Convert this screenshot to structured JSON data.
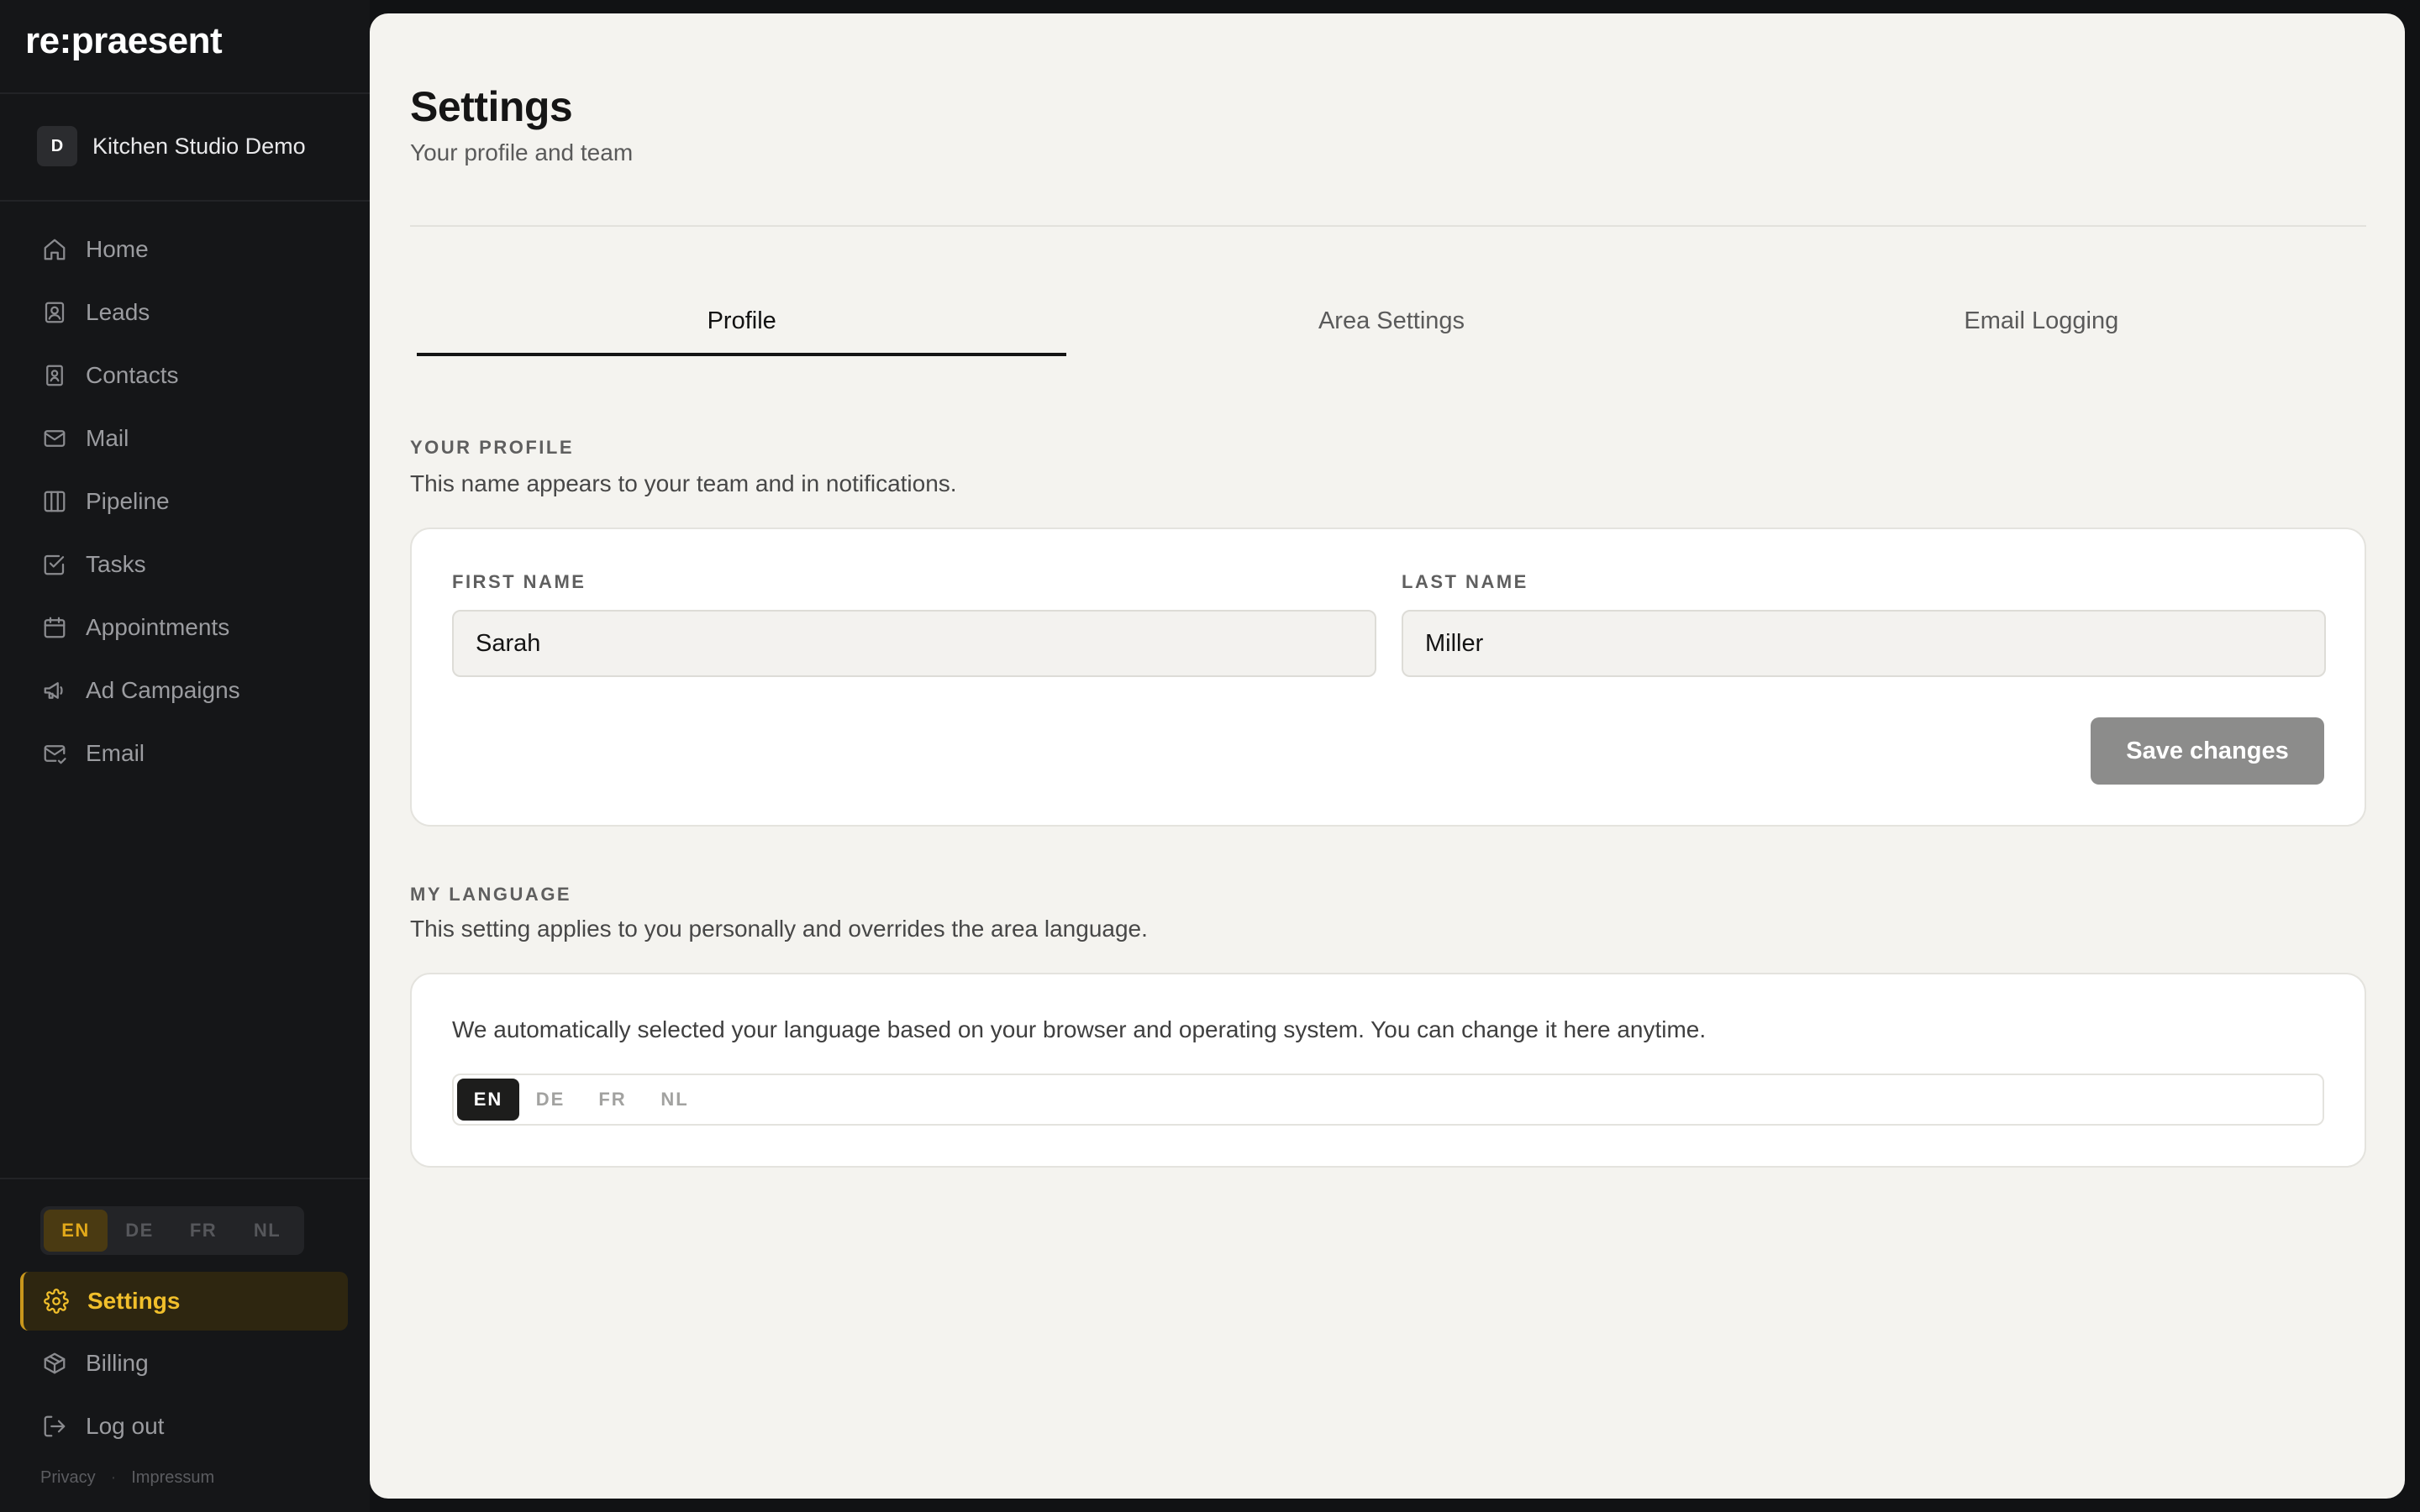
{
  "app": {
    "logo": "re:praesent"
  },
  "workspace": {
    "avatar_letter": "D",
    "name": "Kitchen Studio Demo"
  },
  "sidebar": {
    "items": [
      {
        "label": "Home",
        "icon": "home-icon"
      },
      {
        "label": "Leads",
        "icon": "lead-badge-icon"
      },
      {
        "label": "Contacts",
        "icon": "contact-card-icon"
      },
      {
        "label": "Mail",
        "icon": "mail-icon"
      },
      {
        "label": "Pipeline",
        "icon": "columns-icon"
      },
      {
        "label": "Tasks",
        "icon": "checkbox-icon"
      },
      {
        "label": "Appointments",
        "icon": "calendar-icon"
      },
      {
        "label": "Ad Campaigns",
        "icon": "megaphone-icon"
      },
      {
        "label": "Email",
        "icon": "mail-check-icon"
      }
    ],
    "languages": [
      "EN",
      "DE",
      "FR",
      "NL"
    ],
    "active_language": "EN",
    "settings_label": "Settings",
    "billing_label": "Billing",
    "logout_label": "Log out",
    "footer": {
      "privacy": "Privacy",
      "dot": "·",
      "impressum": "Impressum"
    },
    "accent_color": "#f1bf2b"
  },
  "page": {
    "title": "Settings",
    "subtitle": "Your profile and team",
    "tabs": [
      {
        "label": "Profile",
        "active": true
      },
      {
        "label": "Area Settings",
        "active": false
      },
      {
        "label": "Email Logging",
        "active": false
      }
    ]
  },
  "profile": {
    "section_label": "YOUR PROFILE",
    "section_desc": "This name appears to your team and in notifications.",
    "first_name_label": "FIRST NAME",
    "first_name_value": "Sarah",
    "last_name_label": "LAST NAME",
    "last_name_value": "Miller",
    "save_label": "Save changes"
  },
  "language": {
    "section_label": "MY LANGUAGE",
    "section_desc": "This setting applies to you personally and overrides the area language.",
    "info": "We automatically selected your language based on your browser and operating system. You can change it here anytime.",
    "options": [
      "EN",
      "DE",
      "FR",
      "NL"
    ],
    "selected": "EN"
  }
}
